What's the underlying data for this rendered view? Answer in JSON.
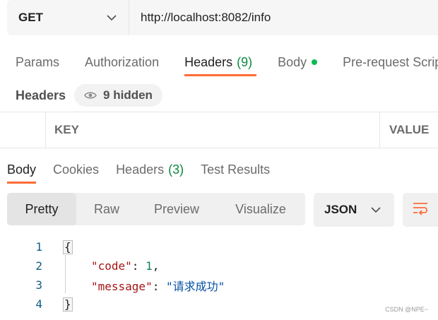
{
  "request": {
    "method": "GET",
    "url": "http://localhost:8082/info"
  },
  "request_tabs": [
    {
      "label": "Params"
    },
    {
      "label": "Authorization"
    },
    {
      "label": "Headers",
      "count": "(9)"
    },
    {
      "label": "Body"
    },
    {
      "label": "Pre-request Script"
    }
  ],
  "headers_section": {
    "title": "Headers",
    "hidden_label": "9 hidden"
  },
  "headers_table": {
    "columns": [
      "KEY",
      "VALUE"
    ]
  },
  "response_tabs": [
    {
      "label": "Body"
    },
    {
      "label": "Cookies"
    },
    {
      "label": "Headers",
      "count": "(3)"
    },
    {
      "label": "Test Results"
    }
  ],
  "view_modes": [
    "Pretty",
    "Raw",
    "Preview",
    "Visualize"
  ],
  "format": "JSON",
  "response_body": {
    "line_numbers": [
      "1",
      "2",
      "3",
      "4"
    ],
    "open_brace": "{",
    "close_brace": "}",
    "k1": "\"code\"",
    "v1": "1",
    "k2": "\"message\"",
    "v2": "\"请求成功\"",
    "colon": ": ",
    "comma": ","
  },
  "watermark": "CSDN @NPE~",
  "colors": {
    "accent": "#ff6c37",
    "count_green": "#0a8a3e",
    "dot_green": "#0cbb52",
    "json_key": "#a31515",
    "json_number": "#098658",
    "json_string": "#0451a5"
  }
}
